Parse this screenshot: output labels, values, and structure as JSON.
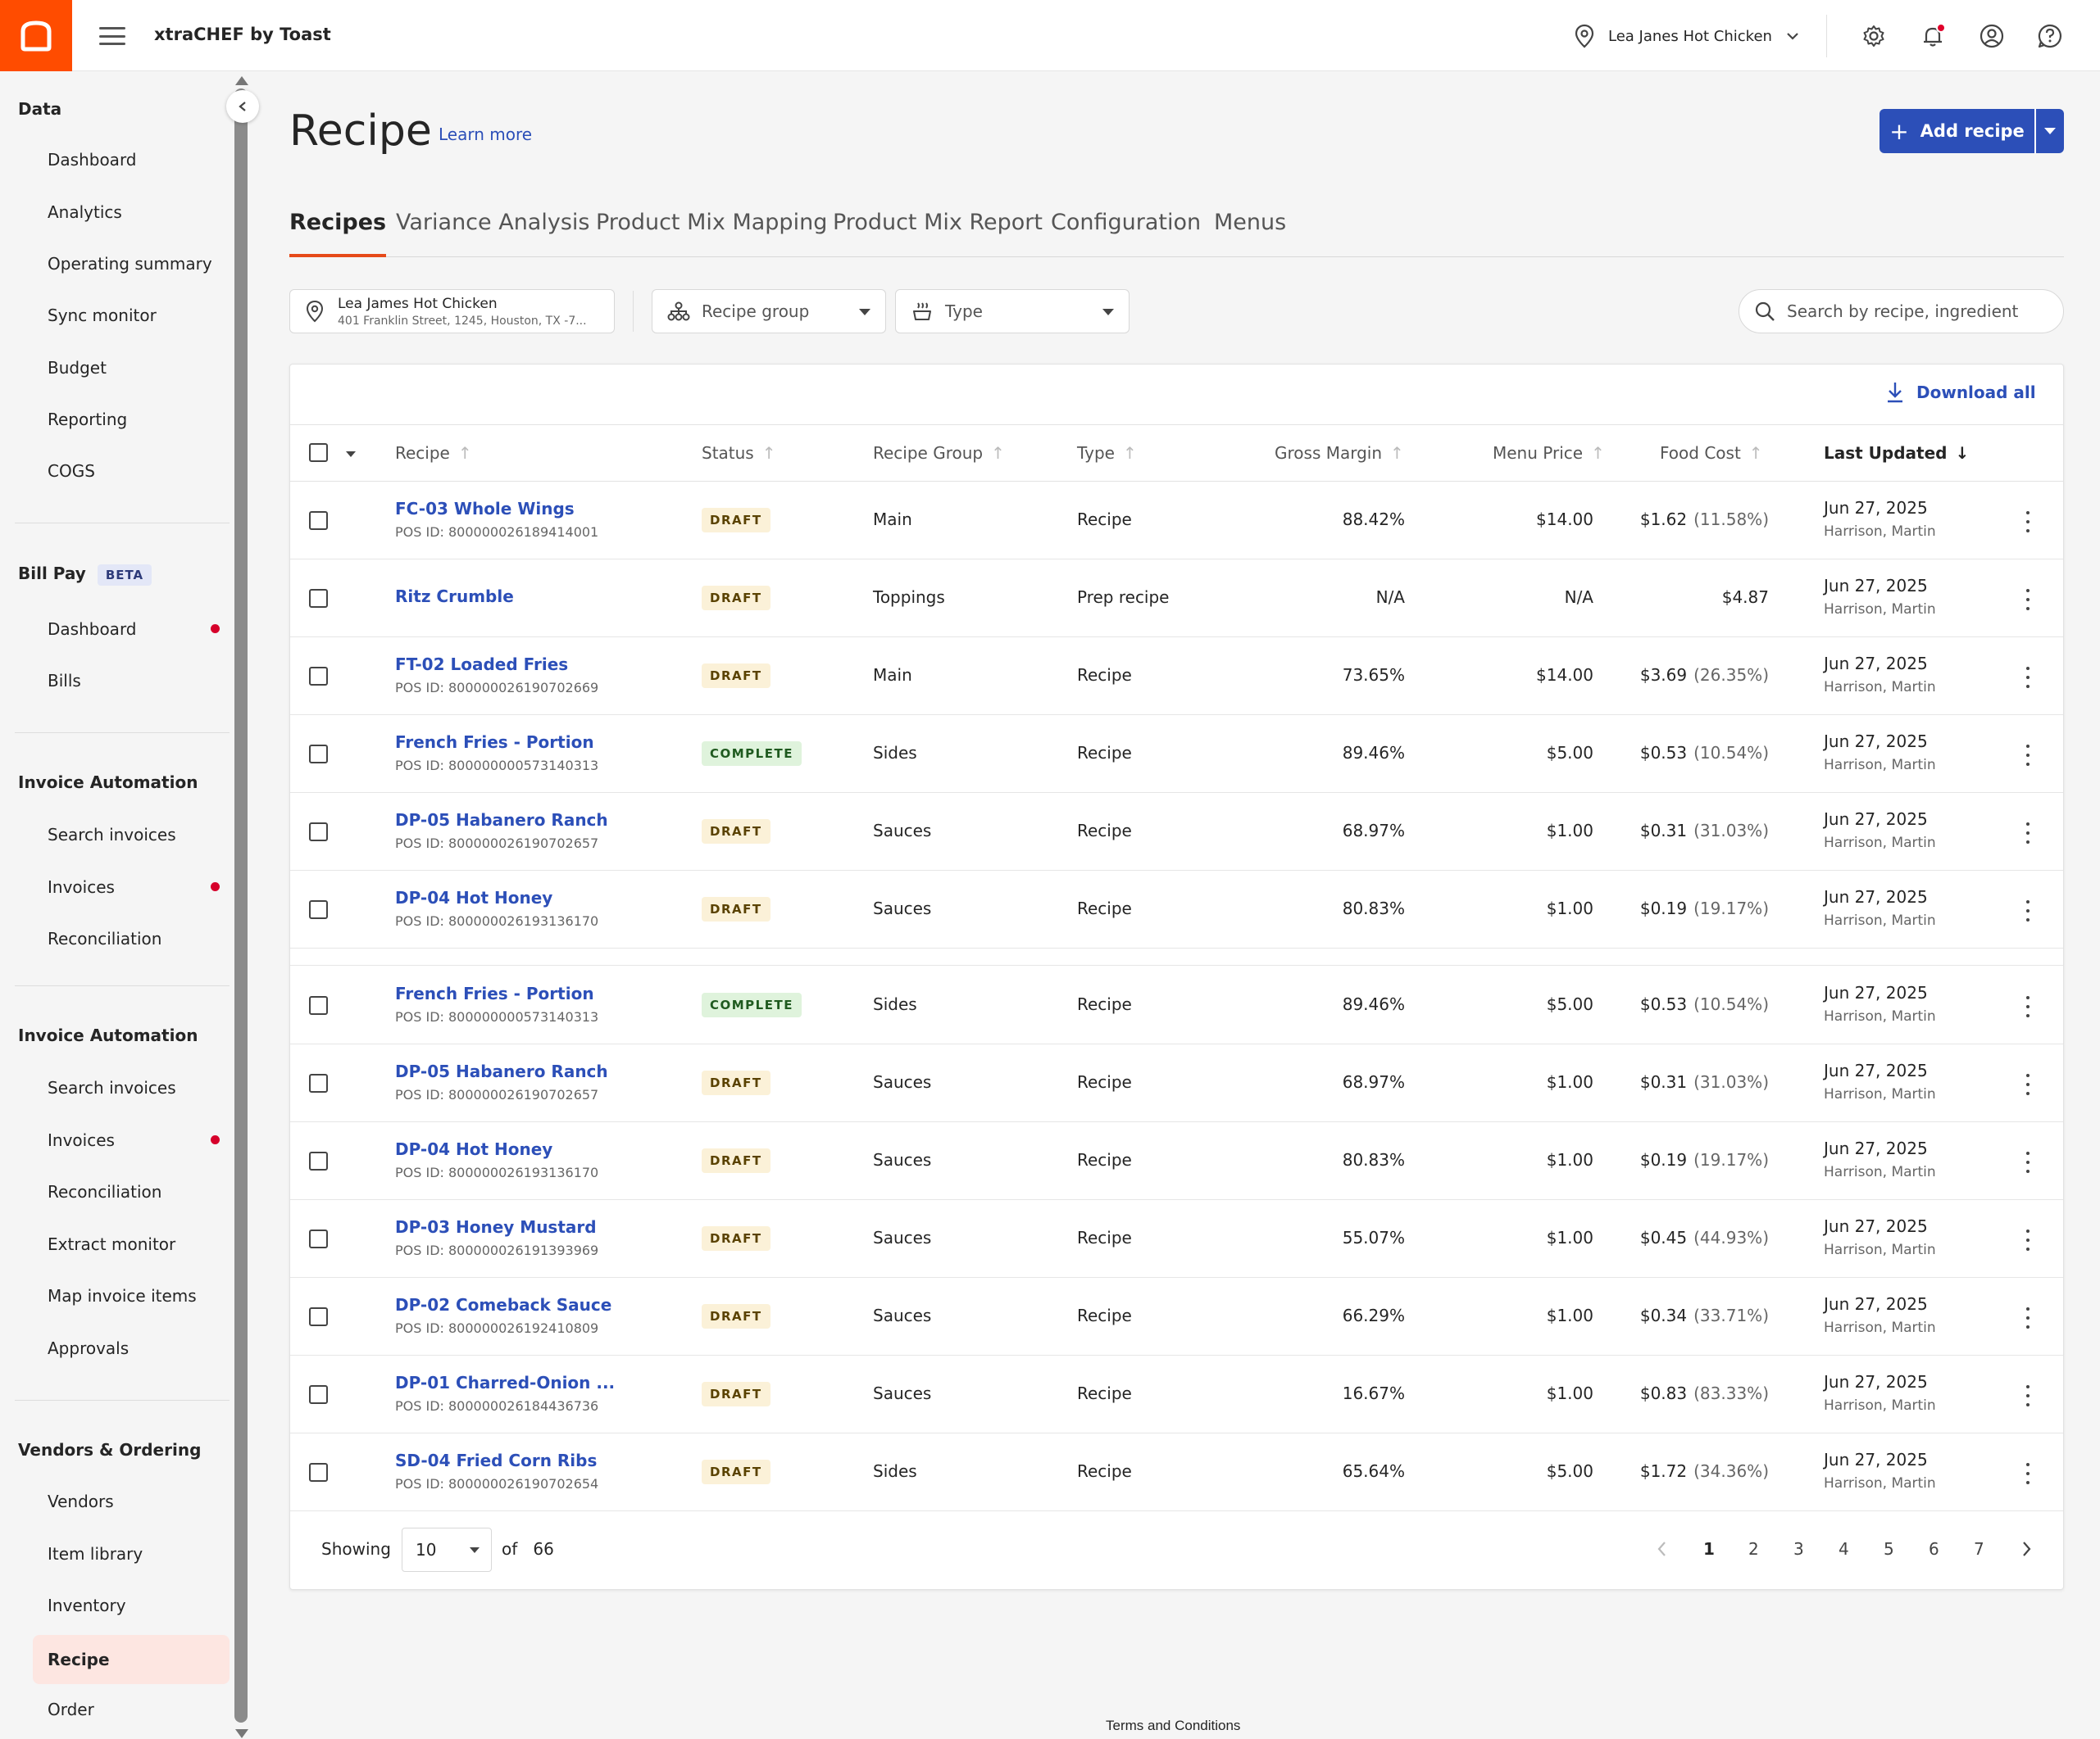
{
  "app": {
    "title": "xtraCHEF by Toast",
    "location": "Lea Janes Hot Chicken"
  },
  "colors": {
    "brand": "#ff4c00",
    "primary": "#2c4fb8",
    "tab_underline": "#e64a19",
    "alert_dot": "#d6002a"
  },
  "sidebar": {
    "sections": [
      {
        "title": "Data",
        "items": [
          {
            "label": "Dashboard"
          },
          {
            "label": "Analytics"
          },
          {
            "label": "Operating summary"
          },
          {
            "label": "Sync monitor"
          },
          {
            "label": "Budget"
          },
          {
            "label": "Reporting"
          },
          {
            "label": "COGS"
          }
        ]
      },
      {
        "title": "Bill Pay",
        "badge": "BETA",
        "items": [
          {
            "label": "Dashboard",
            "dot": true
          },
          {
            "label": "Bills"
          }
        ]
      },
      {
        "title": "Invoice Automation",
        "items": [
          {
            "label": "Search invoices"
          },
          {
            "label": "Invoices",
            "dot": true
          },
          {
            "label": "Reconciliation"
          }
        ]
      },
      {
        "title": "Invoice Automation",
        "items": [
          {
            "label": "Search invoices"
          },
          {
            "label": "Invoices",
            "dot": true
          },
          {
            "label": "Reconciliation"
          },
          {
            "label": "Extract monitor"
          },
          {
            "label": "Map invoice items"
          },
          {
            "label": "Approvals"
          }
        ]
      },
      {
        "title": "Vendors & Ordering",
        "items": [
          {
            "label": "Vendors"
          },
          {
            "label": "Item library"
          },
          {
            "label": "Inventory"
          },
          {
            "label": "Recipe",
            "active": true
          },
          {
            "label": "Order"
          }
        ]
      }
    ]
  },
  "page": {
    "title": "Recipe",
    "learn_more": "Learn more",
    "add_button": "Add recipe",
    "tabs": [
      "Recipes",
      "Variance Analysis",
      "Product Mix Mapping",
      "Product Mix Report",
      "Configuration",
      "Menus"
    ],
    "filters": {
      "location_name": "Lea James Hot Chicken",
      "location_address": "401 Franklin Street, 1245, Houston, TX -7...",
      "recipe_group": "Recipe group",
      "type": "Type",
      "search_placeholder": "Search by recipe, ingredient"
    },
    "download_all": "Download all"
  },
  "table": {
    "columns": [
      "Recipe",
      "Status",
      "Recipe Group",
      "Type",
      "Gross Margin",
      "Menu Price",
      "Food Cost",
      "Last Updated"
    ],
    "rows": [
      {
        "name": "FC-03 Whole Wings",
        "pos": "POS ID: 800000026189414001",
        "status": "DRAFT",
        "group": "Main",
        "type": "Recipe",
        "margin": "88.42%",
        "price": "$14.00",
        "cost": "$1.62",
        "cost_pct": "(11.58%)",
        "date": "Jun 27, 2025",
        "by": "Harrison, Martin"
      },
      {
        "name": "Ritz Crumble",
        "pos": "",
        "status": "DRAFT",
        "group": "Toppings",
        "type": "Prep recipe",
        "margin": "N/A",
        "price": "N/A",
        "cost": "$4.87",
        "cost_pct": "",
        "date": "Jun 27, 2025",
        "by": "Harrison, Martin"
      },
      {
        "name": "FT-02 Loaded Fries",
        "pos": "POS ID: 800000026190702669",
        "status": "DRAFT",
        "group": "Main",
        "type": "Recipe",
        "margin": "73.65%",
        "price": "$14.00",
        "cost": "$3.69",
        "cost_pct": "(26.35%)",
        "date": "Jun 27, 2025",
        "by": "Harrison, Martin"
      },
      {
        "name": "French Fries - Portion",
        "pos": "POS ID: 800000000573140313",
        "status": "COMPLETE",
        "group": "Sides",
        "type": "Recipe",
        "margin": "89.46%",
        "price": "$5.00",
        "cost": "$0.53",
        "cost_pct": "(10.54%)",
        "date": "Jun 27, 2025",
        "by": "Harrison, Martin"
      },
      {
        "name": "DP-05 Habanero Ranch",
        "pos": "POS ID: 800000026190702657",
        "status": "DRAFT",
        "group": "Sauces",
        "type": "Recipe",
        "margin": "68.97%",
        "price": "$1.00",
        "cost": "$0.31",
        "cost_pct": "(31.03%)",
        "date": "Jun 27, 2025",
        "by": "Harrison, Martin"
      },
      {
        "name": "DP-04 Hot Honey",
        "pos": "POS ID: 800000026193136170",
        "status": "DRAFT",
        "group": "Sauces",
        "type": "Recipe",
        "margin": "80.83%",
        "price": "$1.00",
        "cost": "$0.19",
        "cost_pct": "(19.17%)",
        "date": "Jun 27, 2025",
        "by": "Harrison, Martin"
      },
      {
        "name": "French Fries - Portion",
        "pos": "POS ID: 800000000573140313",
        "status": "COMPLETE",
        "group": "Sides",
        "type": "Recipe",
        "margin": "89.46%",
        "price": "$5.00",
        "cost": "$0.53",
        "cost_pct": "(10.54%)",
        "date": "Jun 27, 2025",
        "by": "Harrison, Martin"
      },
      {
        "name": "DP-05 Habanero Ranch",
        "pos": "POS ID: 800000026190702657",
        "status": "DRAFT",
        "group": "Sauces",
        "type": "Recipe",
        "margin": "68.97%",
        "price": "$1.00",
        "cost": "$0.31",
        "cost_pct": "(31.03%)",
        "date": "Jun 27, 2025",
        "by": "Harrison, Martin"
      },
      {
        "name": "DP-04 Hot Honey",
        "pos": "POS ID: 800000026193136170",
        "status": "DRAFT",
        "group": "Sauces",
        "type": "Recipe",
        "margin": "80.83%",
        "price": "$1.00",
        "cost": "$0.19",
        "cost_pct": "(19.17%)",
        "date": "Jun 27, 2025",
        "by": "Harrison, Martin"
      },
      {
        "name": "DP-03 Honey Mustard",
        "pos": "POS ID: 800000026191393969",
        "status": "DRAFT",
        "group": "Sauces",
        "type": "Recipe",
        "margin": "55.07%",
        "price": "$1.00",
        "cost": "$0.45",
        "cost_pct": "(44.93%)",
        "date": "Jun 27, 2025",
        "by": "Harrison, Martin"
      },
      {
        "name": "DP-02 Comeback Sauce",
        "pos": "POS ID: 800000026192410809",
        "status": "DRAFT",
        "group": "Sauces",
        "type": "Recipe",
        "margin": "66.29%",
        "price": "$1.00",
        "cost": "$0.34",
        "cost_pct": "(33.71%)",
        "date": "Jun 27, 2025",
        "by": "Harrison, Martin"
      },
      {
        "name": "DP-01 Charred-Onion ...",
        "pos": "POS ID: 800000026184436736",
        "status": "DRAFT",
        "group": "Sauces",
        "type": "Recipe",
        "margin": "16.67%",
        "price": "$1.00",
        "cost": "$0.83",
        "cost_pct": "(83.33%)",
        "date": "Jun 27, 2025",
        "by": "Harrison, Martin"
      },
      {
        "name": "SD-04 Fried Corn Ribs",
        "pos": "POS ID: 800000026190702654",
        "status": "DRAFT",
        "group": "Sides",
        "type": "Recipe",
        "margin": "65.64%",
        "price": "$5.00",
        "cost": "$1.72",
        "cost_pct": "(34.36%)",
        "date": "Jun 27, 2025",
        "by": "Harrison, Martin"
      }
    ]
  },
  "pagination": {
    "showing_label": "Showing",
    "page_size": "10",
    "of_label": "of",
    "total": "66",
    "pages": [
      "1",
      "2",
      "3",
      "4",
      "5",
      "6",
      "7"
    ],
    "current": "1"
  },
  "footer": {
    "terms": "Terms and Conditions"
  }
}
